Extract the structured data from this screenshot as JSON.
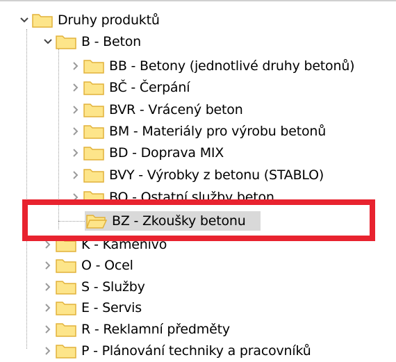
{
  "tree": {
    "root": {
      "label": "Druhy produktů",
      "expanded": true
    },
    "beton": {
      "label": "B - Beton",
      "expanded": true
    },
    "beton_children": [
      {
        "label": "BB - Betony (jednotlivé druhy betonů)"
      },
      {
        "label": "BČ - Čerpání"
      },
      {
        "label": "BVR - Vrácený beton"
      },
      {
        "label": "BM - Materiály pro výrobu betonů"
      },
      {
        "label": "BD - Doprava MIX"
      },
      {
        "label": "BVY - Výrobky z betonu (STABLO)"
      },
      {
        "label": "BO - Ostatní služby beton"
      }
    ],
    "selected": {
      "label": "BZ - Zkoušky betonu"
    },
    "top_level": [
      {
        "label": "K - Kamenivo"
      },
      {
        "label": "O - Ocel"
      },
      {
        "label": "S - Služby"
      },
      {
        "label": "E - Servis"
      },
      {
        "label": "R - Reklamní předměty"
      },
      {
        "label": "P - Plánování techniky a pracovníků"
      }
    ]
  },
  "colors": {
    "folder_fill": "#fde58a",
    "folder_edge": "#e2b23a",
    "highlight": "#e8232f",
    "selection": "#d9d9d9"
  }
}
